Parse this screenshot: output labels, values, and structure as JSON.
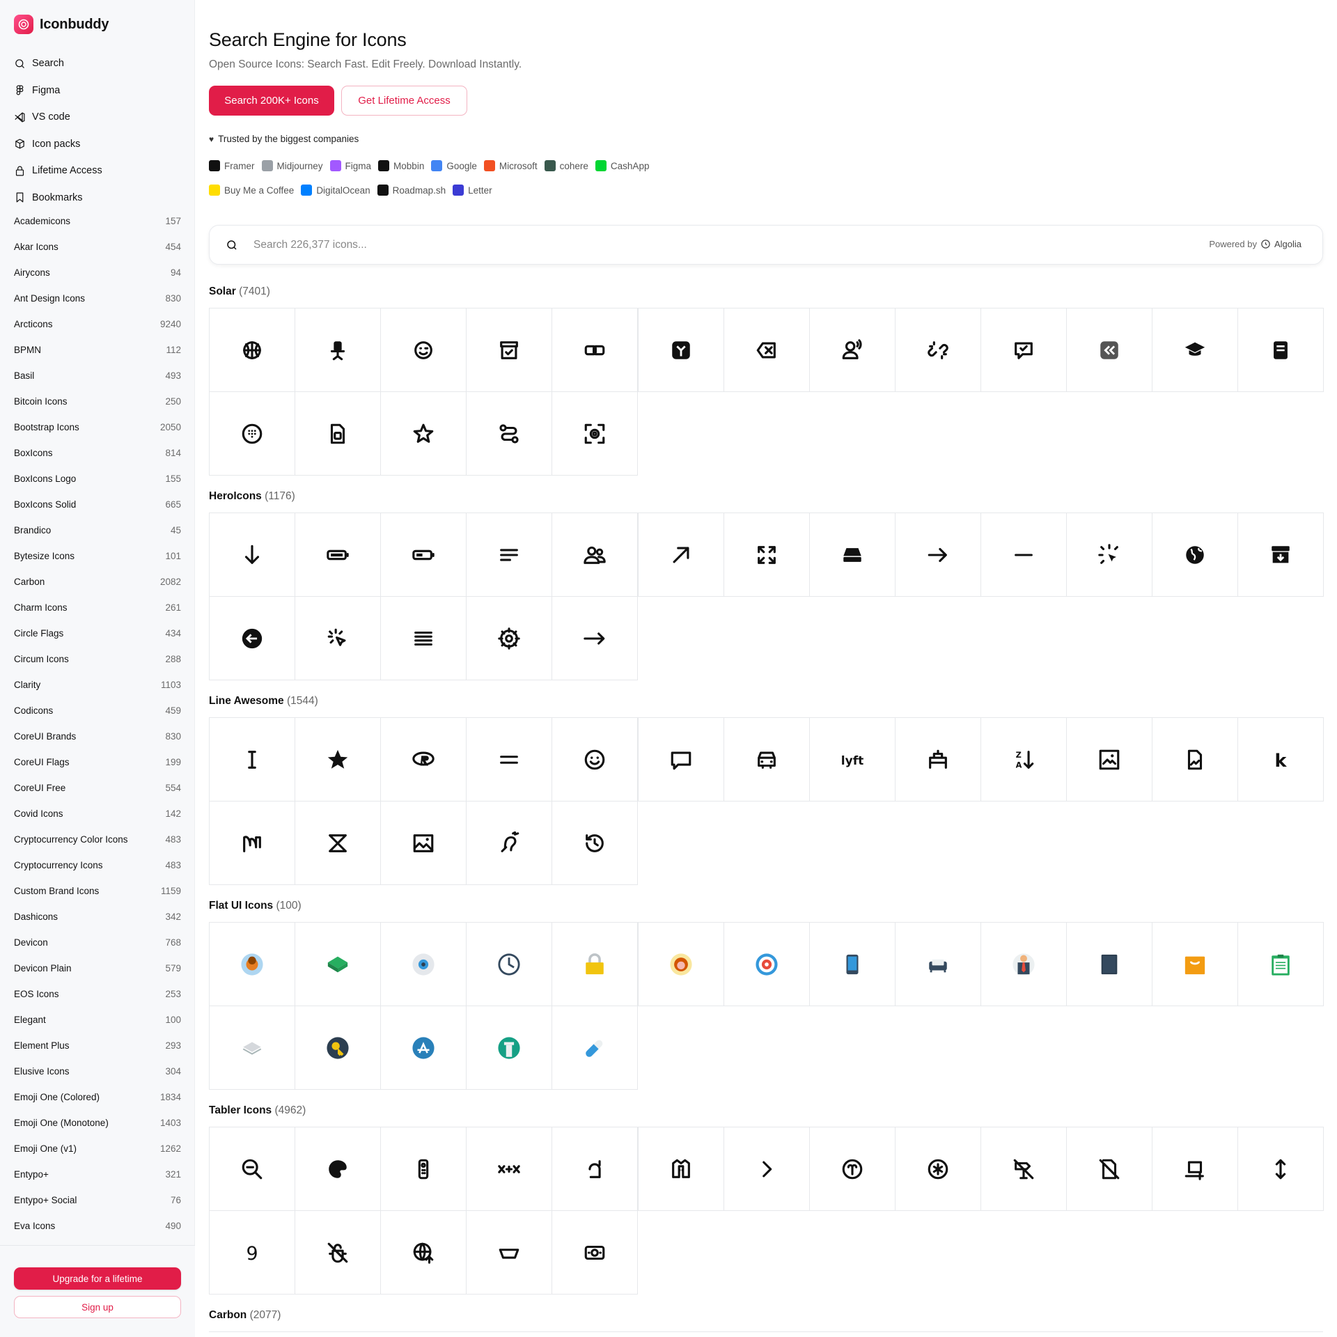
{
  "brand": {
    "name": "Iconbuddy"
  },
  "nav": [
    {
      "label": "Search",
      "icon": "search-icon"
    },
    {
      "label": "Figma",
      "icon": "figma-icon"
    },
    {
      "label": "VS code",
      "icon": "vscode-icon"
    },
    {
      "label": "Icon packs",
      "icon": "box-icon"
    },
    {
      "label": "Lifetime Access",
      "icon": "lock-icon"
    },
    {
      "label": "Bookmarks",
      "icon": "bookmark-icon"
    }
  ],
  "packs": [
    {
      "name": "Academicons",
      "count": "157"
    },
    {
      "name": "Akar Icons",
      "count": "454"
    },
    {
      "name": "Airycons",
      "count": "94"
    },
    {
      "name": "Ant Design Icons",
      "count": "830"
    },
    {
      "name": "Arcticons",
      "count": "9240"
    },
    {
      "name": "BPMN",
      "count": "112"
    },
    {
      "name": "Basil",
      "count": "493"
    },
    {
      "name": "Bitcoin Icons",
      "count": "250"
    },
    {
      "name": "Bootstrap Icons",
      "count": "2050"
    },
    {
      "name": "BoxIcons",
      "count": "814"
    },
    {
      "name": "BoxIcons Logo",
      "count": "155"
    },
    {
      "name": "BoxIcons Solid",
      "count": "665"
    },
    {
      "name": "Brandico",
      "count": "45"
    },
    {
      "name": "Bytesize Icons",
      "count": "101"
    },
    {
      "name": "Carbon",
      "count": "2082"
    },
    {
      "name": "Charm Icons",
      "count": "261"
    },
    {
      "name": "Circle Flags",
      "count": "434"
    },
    {
      "name": "Circum Icons",
      "count": "288"
    },
    {
      "name": "Clarity",
      "count": "1103"
    },
    {
      "name": "Codicons",
      "count": "459"
    },
    {
      "name": "CoreUI Brands",
      "count": "830"
    },
    {
      "name": "CoreUI Flags",
      "count": "199"
    },
    {
      "name": "CoreUI Free",
      "count": "554"
    },
    {
      "name": "Covid Icons",
      "count": "142"
    },
    {
      "name": "Cryptocurrency Color Icons",
      "count": "483"
    },
    {
      "name": "Cryptocurrency Icons",
      "count": "483"
    },
    {
      "name": "Custom Brand Icons",
      "count": "1159"
    },
    {
      "name": "Dashicons",
      "count": "342"
    },
    {
      "name": "Devicon",
      "count": "768"
    },
    {
      "name": "Devicon Plain",
      "count": "579"
    },
    {
      "name": "EOS Icons",
      "count": "253"
    },
    {
      "name": "Elegant",
      "count": "100"
    },
    {
      "name": "Element Plus",
      "count": "293"
    },
    {
      "name": "Elusive Icons",
      "count": "304"
    },
    {
      "name": "Emoji One (Colored)",
      "count": "1834"
    },
    {
      "name": "Emoji One (Monotone)",
      "count": "1403"
    },
    {
      "name": "Emoji One (v1)",
      "count": "1262"
    },
    {
      "name": "Entypo+",
      "count": "321"
    },
    {
      "name": "Entypo+ Social",
      "count": "76"
    },
    {
      "name": "Eva Icons",
      "count": "490"
    }
  ],
  "footer": {
    "upgrade": "Upgrade for a lifetime",
    "signup": "Sign up"
  },
  "hero": {
    "title": "Search Engine for Icons",
    "subtitle": "Open Source Icons: Search Fast. Edit Freely. Download Instantly.",
    "cta_primary": "Search 200K+ Icons",
    "cta_secondary": "Get Lifetime Access",
    "trusted": "Trusted by the biggest companies"
  },
  "companies_row1": [
    {
      "name": "Framer",
      "color": "#111111"
    },
    {
      "name": "Midjourney",
      "color": "#9aa0a6"
    },
    {
      "name": "Figma",
      "color": "#a259ff"
    },
    {
      "name": "Mobbin",
      "color": "#111111"
    },
    {
      "name": "Google",
      "color": "#4285f4"
    },
    {
      "name": "Microsoft",
      "color": "#f25022"
    },
    {
      "name": "cohere",
      "color": "#39594d"
    },
    {
      "name": "CashApp",
      "color": "#00d632"
    }
  ],
  "companies_row2": [
    {
      "name": "Buy Me a Coffee",
      "color": "#ffdd00"
    },
    {
      "name": "DigitalOcean",
      "color": "#0080ff"
    },
    {
      "name": "Roadmap.sh",
      "color": "#111111"
    },
    {
      "name": "Letter",
      "color": "#3b3bd4"
    }
  ],
  "search": {
    "placeholder": "Search 226,377 icons...",
    "powered_by": "Powered by",
    "provider": "Algolia"
  },
  "sections": [
    {
      "name": "Solar",
      "count": "(7401)",
      "icons": [
        "basketball-icon",
        "office-chair-icon",
        "smile-wink-icon",
        "archive-check-icon",
        "link-square-icon",
        "t-shirt-icon",
        "backspace-icon",
        "user-speak-icon",
        "link-broken-icon",
        "chat-check-icon",
        "double-alt-left-icon",
        "graduation-cap-icon",
        "book-icon",
        "dialpad-icon",
        "sim-card-icon",
        "star-shine-icon",
        "route-icon",
        "gear-scan-icon"
      ]
    },
    {
      "name": "HeroIcons",
      "count": "(1176)",
      "icons": [
        "arrow-down-icon",
        "battery-full-icon",
        "battery-half-icon",
        "bars-left-icon",
        "users-icon",
        "arrow-up-right-icon",
        "expand-icon",
        "server-icon",
        "arrow-right-icon",
        "minus-icon",
        "cursor-rays-icon",
        "globe-icon",
        "archive-down-icon",
        "arrow-left-circle-icon",
        "cursor-click-icon",
        "bars-four-icon",
        "cog-icon",
        "arrow-long-right-icon"
      ]
    },
    {
      "name": "Line Awesome",
      "count": "(1544)",
      "icons": [
        "i-cursor-icon",
        "star-icon",
        "r-project-icon",
        "equals-icon",
        "smile-icon",
        "comment-icon",
        "car-icon",
        "lyft-icon",
        "hotel-icon",
        "sort-alpha-down-icon",
        "image-square-icon",
        "file-image-icon",
        "k-letter-icon",
        "mendeley-icon",
        "fly-icon",
        "image-icon",
        "deaf-icon",
        "history-icon"
      ]
    },
    {
      "name": "Flat UI Icons",
      "count": "(100)",
      "icons": [
        "boy-avatar-icon",
        "gem-icon",
        "eye-icon",
        "clock-icon",
        "lock-icon",
        "girl-avatar-icon",
        "target-icon",
        "smartphone-icon",
        "sofa-icon",
        "businessman-icon",
        "tablet-icon",
        "shopping-bag-icon",
        "clipboard-icon",
        "mail-stack-icon",
        "key-icon",
        "app-store-icon",
        "column-icon",
        "pill-icon"
      ]
    },
    {
      "name": "Tabler Icons",
      "count": "(4962)",
      "icons": [
        "zoom-out-icon",
        "palette-icon",
        "remote-icon",
        "math-x-plus-x-icon",
        "currency-dram-icon",
        "jacket-icon",
        "chevron-right-icon",
        "zodiac-aries-icon",
        "asterisk-circle-icon",
        "direction-sign-off-icon",
        "file-off-icon",
        "device-laptop-plus-icon",
        "arrow-autofit-height-icon",
        "number-nine-icon",
        "bug-off-icon",
        "world-upload-icon",
        "bowl-icon",
        "cash-banknote-icon"
      ]
    },
    {
      "name": "Carbon",
      "count": "(2077)",
      "icons": []
    }
  ]
}
